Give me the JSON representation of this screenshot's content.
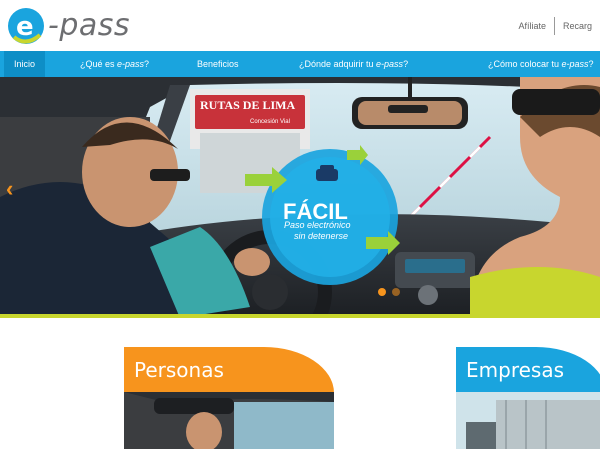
{
  "brand": {
    "logo_letter": "e",
    "logo_text": "-pass"
  },
  "top_links": {
    "affiliate": "Afíliate",
    "recharge": "Recarg"
  },
  "nav": {
    "items": [
      {
        "label": "Inicio",
        "active": true
      },
      {
        "label_pre": "¿Qué es ",
        "label_em": "e-pass",
        "label_post": "?"
      },
      {
        "label": "Beneficios"
      },
      {
        "label_pre": "¿Dónde adquirir tu ",
        "label_em": "e-pass",
        "label_post": "?"
      },
      {
        "label_pre": "¿Cómo colocar tu ",
        "label_em": "e-pass",
        "label_post": "?"
      }
    ]
  },
  "hero": {
    "headline": "FÁCIL",
    "subtitle_line1": "Paso electrónico",
    "subtitle_line2": "sin detenerse",
    "toll_sign": "RUTAS DE LIMA",
    "toll_sign_sub": "Concesión Vial",
    "prev_arrow": "‹",
    "slide_count": 2,
    "active_slide": 2
  },
  "cards": {
    "personas": {
      "title": "Personas"
    },
    "empresas": {
      "title": "Empresas"
    }
  },
  "colors": {
    "brand_blue": "#1aa4de",
    "nav_active": "#0e8ec6",
    "orange": "#f7941d",
    "lime": "#c8d62e",
    "logo_gray": "#6d6e71"
  }
}
